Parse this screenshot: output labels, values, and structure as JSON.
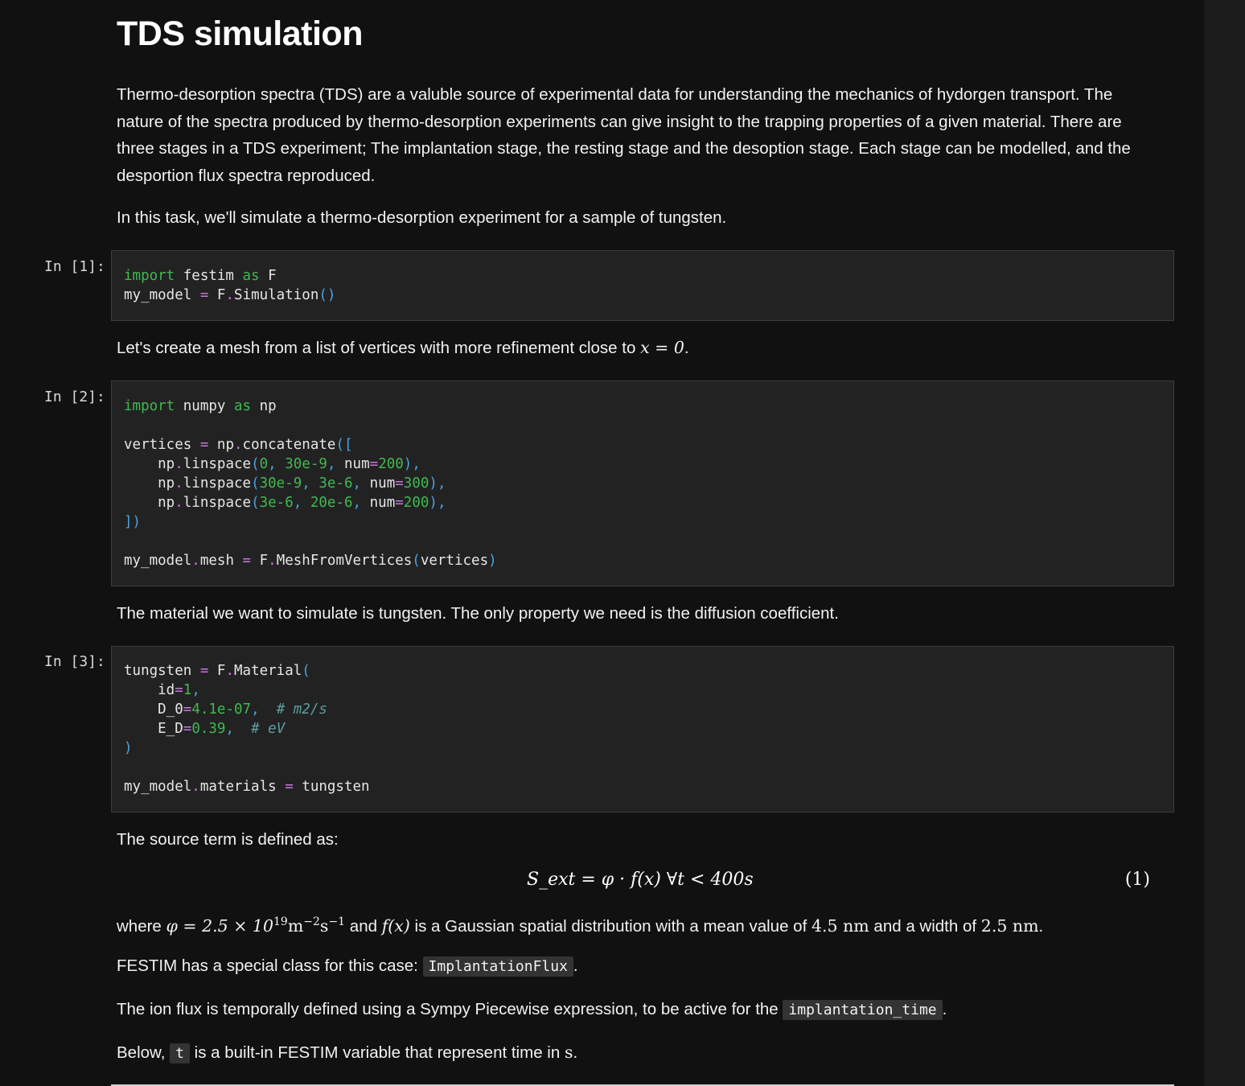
{
  "title": "TDS simulation",
  "intro": {
    "p1": "Thermo-desorption spectra (TDS) are a valuble source of experimental data for understanding the mechanics of hydorgen transport. The nature of the spectra produced by thermo-desorption experiments can give insight to the trapping properties of a given material. There are three stages in a TDS experiment; The implantation stage, the resting stage and the desoption stage. Each stage can be modelled, and the desportion flux spectra reproduced.",
    "p2": "In this task, we'll simulate a thermo-desorption experiment for a sample of tungsten."
  },
  "cells": [
    {
      "prompt": "In [1]:"
    },
    {
      "prompt": "In [2]:"
    },
    {
      "prompt": "In [3]:"
    }
  ],
  "mesh_text": {
    "before": "Let's create a mesh from a list of vertices with more refinement close to ",
    "math": "x = 0",
    "after": "."
  },
  "material_text": "The material we want to simulate is tungsten. The only property we need is the diffusion coefficient.",
  "source_text": "The source term is defined as:",
  "equation": {
    "body": "S_ext = φ · f(x)   ∀t < 400s",
    "number": "(1)"
  },
  "where_text": {
    "w1": "where ",
    "phi": "φ = 2.5 × 10",
    "exp": "19",
    "unit1": "m",
    "exp2": "−2",
    "unit2": "s",
    "exp3": "−1",
    "w2": " and ",
    "fx": "f(x)",
    "w3": " is a Gaussian spatial distribution with a mean value of ",
    "mean": "4.5 nm",
    "w4": " and a width of ",
    "width": "2.5 nm",
    "w5": "."
  },
  "festim_text": {
    "before": "FESTIM has a special class for this case: ",
    "code": "ImplantationFlux",
    "after": "."
  },
  "ionflux_text": {
    "before": "The ion flux is temporally defined using a Sympy Piecewise expression, to be active for the ",
    "code": "implantation_time",
    "after": "."
  },
  "below_text": {
    "before": "Below, ",
    "code": "t",
    "after": " is a built-in FESTIM variable that represent time in ",
    "unit": "s",
    "end": "."
  },
  "code": {
    "c1": {
      "import": "import",
      "festim": " festim ",
      "as": "as",
      "F": " F",
      "l2a": "my_model ",
      "eq": "=",
      "l2b": " F",
      "dot": ".",
      "l2c": "Simulation",
      "po": "(",
      "pc": ")"
    },
    "c2": {
      "import": "import",
      "numpy": " numpy ",
      "as": "as",
      "np": " np",
      "v": "vertices ",
      "eq": "=",
      "npc": " np",
      "dot": ".",
      "conc": "concatenate",
      "ob": "([",
      "ind": "    np",
      "lin": "linspace",
      "po": "(",
      "r1a": "0",
      "r1b": "30e-9",
      "r2a": "30e-9",
      "r2b": "3e-6",
      "r3a": "3e-6",
      "r3b": "20e-6",
      "comma": ",",
      "num": " num",
      "n200": "200",
      "n300": "300",
      "pc": ")",
      "close": "])",
      "mm": "my_model",
      "mesh": "mesh ",
      "f": " F",
      "mfv": "MeshFromVertices",
      "arg": "vertices"
    },
    "c3": {
      "t": "tungsten ",
      "eq": "=",
      "f": " F",
      "dot": ".",
      "mat": "Material",
      "po": "(",
      "id": "    id",
      "idv": "1",
      "comma": ",",
      "d0": "    D_0",
      "d0v": "4.1e-07",
      "d0c": "# m2/s",
      "ed": "    E_D",
      "edv": "0.39",
      "edc": "# eV",
      "pc": ")",
      "mm": "my_model",
      "mats": "materials ",
      "tv": " tungsten"
    }
  }
}
